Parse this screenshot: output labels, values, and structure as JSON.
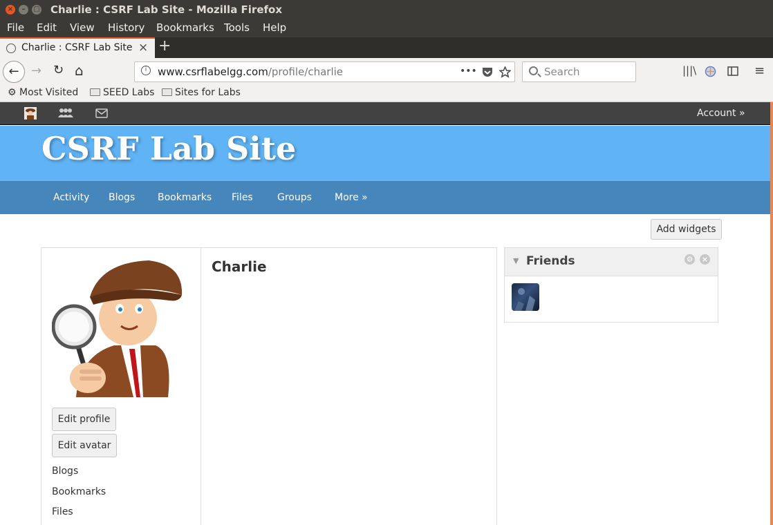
{
  "window": {
    "title": "Charlie : CSRF Lab Site - Mozilla Firefox",
    "close_glyph": "×",
    "minimize_glyph": "–",
    "maximize_glyph": "□"
  },
  "menubar": [
    "File",
    "Edit",
    "View",
    "History",
    "Bookmarks",
    "Tools",
    "Help"
  ],
  "tab": {
    "title": "Charlie : CSRF Lab Site",
    "close": "×",
    "new_tab": "+"
  },
  "navbar": {
    "back": "←",
    "forward": "→",
    "reload": "↻",
    "home": "⌂",
    "url_domain": "www.csrflabelgg.com",
    "url_path": "/profile/charlie",
    "page_actions": "•••",
    "search_placeholder": "Search",
    "library_icon": "|||\\",
    "menu_icon": "≡"
  },
  "bookmarks_bar": [
    "Most Visited",
    "SEED Labs",
    "Sites for Labs"
  ],
  "site": {
    "account_label": "Account »",
    "title": "CSRF Lab Site",
    "nav": [
      "Activity",
      "Blogs",
      "Bookmarks",
      "Files",
      "Groups",
      "More »"
    ],
    "add_widgets": "Add widgets"
  },
  "profile": {
    "name": "Charlie",
    "buttons": [
      "Edit profile",
      "Edit avatar"
    ],
    "links": [
      "Blogs",
      "Bookmarks",
      "Files"
    ]
  },
  "friends_widget": {
    "title": "Friends",
    "collapse_glyph": "▼",
    "settings_glyph": "⚙",
    "close_glyph": "×"
  }
}
